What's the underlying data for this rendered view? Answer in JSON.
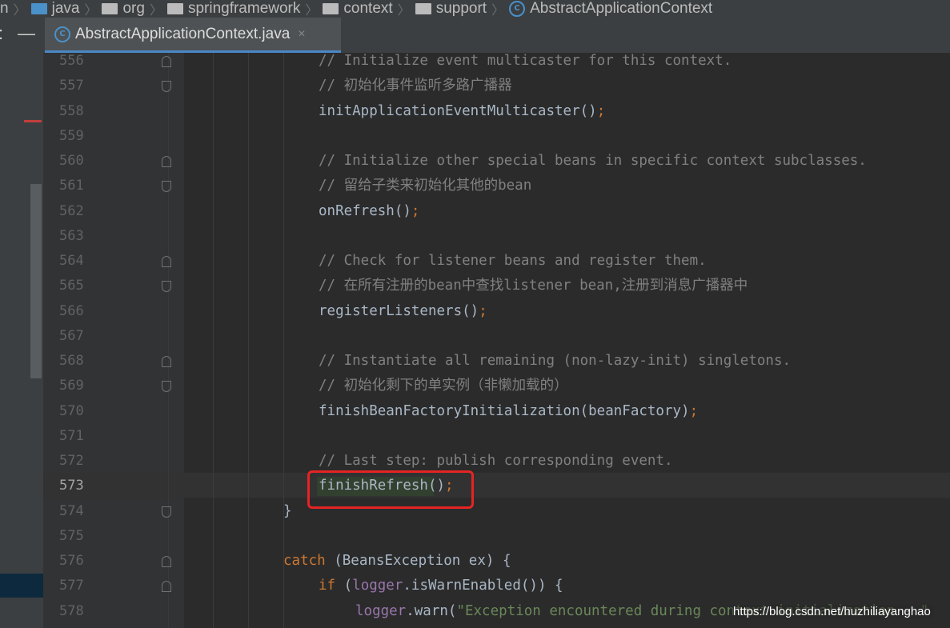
{
  "breadcrumb": {
    "items": [
      {
        "label": "n",
        "icon": "none"
      },
      {
        "label": "java",
        "icon": "folder-icon-blue"
      },
      {
        "label": "org",
        "icon": "package-icon"
      },
      {
        "label": "springframework",
        "icon": "package-icon"
      },
      {
        "label": "context",
        "icon": "package-icon"
      },
      {
        "label": "support",
        "icon": "package-icon"
      },
      {
        "label": "AbstractApplicationContext",
        "icon": "abstract-class-icon"
      }
    ]
  },
  "tabs": {
    "left_tool_1": ":",
    "left_tool_2": "—",
    "file_tab_label": "AbstractApplicationContext.java",
    "close_glyph": "×"
  },
  "editor": {
    "lines": [
      {
        "num": "556",
        "text": "// Initialize event multicaster for this context.",
        "kind": "comment",
        "indent": 398
      },
      {
        "num": "557",
        "text": "// 初始化事件监听多路广播器",
        "kind": "comment",
        "indent": 398
      },
      {
        "num": "558",
        "text": "initApplicationEventMulticaster()",
        "kind": "call",
        "indent": 398
      },
      {
        "num": "559",
        "text": "",
        "kind": "blank",
        "indent": 398
      },
      {
        "num": "560",
        "text": "// Initialize other special beans in specific context subclasses.",
        "kind": "comment",
        "indent": 398
      },
      {
        "num": "561",
        "text": "// 留给子类来初始化其他的bean",
        "kind": "comment",
        "indent": 398
      },
      {
        "num": "562",
        "text": "onRefresh()",
        "kind": "call",
        "indent": 398
      },
      {
        "num": "563",
        "text": "",
        "kind": "blank",
        "indent": 398
      },
      {
        "num": "564",
        "text": "// Check for listener beans and register them.",
        "kind": "comment",
        "indent": 398
      },
      {
        "num": "565",
        "text": "// 在所有注册的bean中查找listener bean,注册到消息广播器中",
        "kind": "comment",
        "indent": 398
      },
      {
        "num": "566",
        "text": "registerListeners()",
        "kind": "call",
        "indent": 398
      },
      {
        "num": "567",
        "text": "",
        "kind": "blank",
        "indent": 398
      },
      {
        "num": "568",
        "text": "// Instantiate all remaining (non-lazy-init) singletons.",
        "kind": "comment",
        "indent": 398
      },
      {
        "num": "569",
        "text": "// 初始化剩下的单实例（非懒加载的）",
        "kind": "comment",
        "indent": 398
      },
      {
        "num": "570",
        "text": "finishBeanFactoryInitialization(beanFactory)",
        "kind": "call",
        "indent": 398
      },
      {
        "num": "571",
        "text": "",
        "kind": "blank",
        "indent": 398
      },
      {
        "num": "572",
        "text": "// Last step: publish corresponding event.",
        "kind": "comment",
        "indent": 398
      },
      {
        "num": "573",
        "text": "finishRefresh()",
        "kind": "call",
        "indent": 398
      },
      {
        "num": "574",
        "text": "}",
        "kind": "plain",
        "indent": 354
      },
      {
        "num": "575",
        "text": "",
        "kind": "blank",
        "indent": 354
      },
      {
        "num": "576",
        "text": "catch (BeansException ex) {",
        "kind": "catch",
        "indent": 354
      },
      {
        "num": "577",
        "text": "if (logger.isWarnEnabled()) {",
        "kind": "if",
        "indent": 398
      },
      {
        "num": "578",
        "text": "logger.warn(\"Exception encountered during context initialization - \"",
        "kind": "warn",
        "indent": 444
      }
    ]
  },
  "watermark": "https://blog.csdn.net/huzhiliayanghao"
}
